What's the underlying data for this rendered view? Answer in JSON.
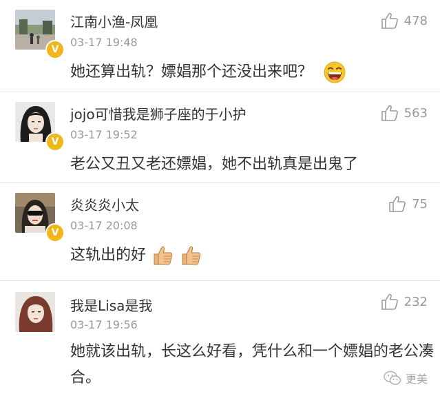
{
  "comments": [
    {
      "username": "江南小渔-凤凰",
      "timestamp": "03-17 19:48",
      "text": "她还算出轨？嫖娼那个还没出来吧？",
      "likes": "478",
      "emoji": "laughing-face-icon"
    },
    {
      "username": "jojo可惜我是狮子座的于小护",
      "timestamp": "03-17 19:52",
      "text": "老公又丑又老还嫖娼，她不出轨真是出鬼了",
      "likes": "563"
    },
    {
      "username": "炎炎炎小太",
      "timestamp": "03-17 20:08",
      "text": "这轨出的好",
      "likes": "75",
      "emoji": "thumbs-up-icon"
    },
    {
      "username": "我是Lisa是我",
      "timestamp": "03-17 19:56",
      "text": "她就该出轨，长这么好看，凭什么和一个嫖娼的老公凑合。",
      "likes": "232"
    }
  ],
  "watermark": {
    "label": "更美"
  },
  "colors": {
    "verified_badge": "#f2b61c",
    "text": "#333333",
    "meta": "#999999",
    "divider": "#e3e3e3"
  }
}
